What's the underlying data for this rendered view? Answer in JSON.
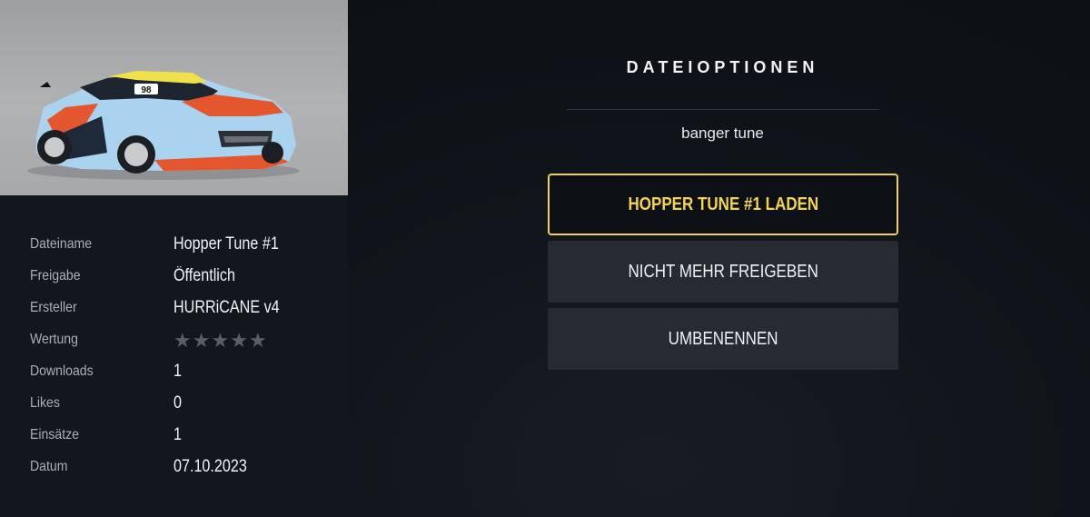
{
  "file_info": {
    "rows": [
      {
        "label": "Dateiname",
        "value": "Hopper Tune #1"
      },
      {
        "label": "Freigabe",
        "value": "Öffentlich"
      },
      {
        "label": "Ersteller",
        "value": "HURRiCANE v4"
      },
      {
        "label": "Wertung",
        "rating": 0,
        "rating_max": 5
      },
      {
        "label": "Downloads",
        "value": "1"
      },
      {
        "label": "Likes",
        "value": "0"
      },
      {
        "label": "Einsätze",
        "value": "1"
      },
      {
        "label": "Datum",
        "value": "07.10.2023"
      }
    ]
  },
  "car": {
    "race_number": "98",
    "livery_colors": {
      "base": "#a9d3ee",
      "accent": "#e4572e",
      "stripe": "#f0e04a"
    }
  },
  "dialog": {
    "title": "DATEIOPTIONEN",
    "description": "banger tune",
    "buttons": [
      {
        "label": "HOPPER TUNE #1 LADEN",
        "selected": true
      },
      {
        "label": "NICHT MEHR FREIGEBEN",
        "selected": false
      },
      {
        "label": "UMBENENNEN",
        "selected": false
      }
    ]
  },
  "colors": {
    "highlight": "#f3cf4a",
    "button_bg": "#262b31",
    "background": "#0f141a"
  }
}
